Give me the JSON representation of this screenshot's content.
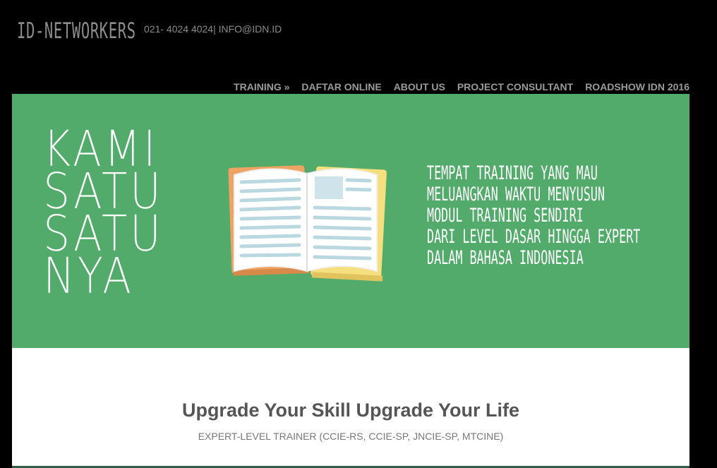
{
  "header": {
    "logo": "ID-NETWORKERS",
    "contact": "021- 4024 4024| INFO@IDN.ID"
  },
  "nav": {
    "items": [
      {
        "label": "TRAINING »"
      },
      {
        "label": "DAFTAR ONLINE"
      },
      {
        "label": "ABOUT US"
      },
      {
        "label": "PROJECT CONSULTANT"
      },
      {
        "label": "ROADSHOW IDN 2016"
      }
    ]
  },
  "hero": {
    "title_lines": [
      "KAMI",
      "SATU",
      "SATU",
      "NYA"
    ],
    "copy_lines": [
      "TEMPAT TRAINING YANG MAU",
      "MELUANGKAN WAKTU MENYUSUN",
      "MODUL TRAINING SENDIRI",
      "DARI LEVEL DASAR HINGGA EXPERT",
      "DALAM BAHASA INDONESIA"
    ],
    "illustration": "open-book-icon"
  },
  "content": {
    "headline": "Upgrade Your Skill Upgrade Your Life",
    "subline": "EXPERT-LEVEL TRAINER (CCIE-RS, CCIE-SP, JNCIE-SP, MTCINE)"
  },
  "colors": {
    "background": "#000000",
    "hero_green": "#52aa6b",
    "nav_text": "#9a9a9a",
    "book_yellow": "#f6df7e",
    "book_orange": "#f0a463",
    "page_blue": "#cfe4ea"
  }
}
